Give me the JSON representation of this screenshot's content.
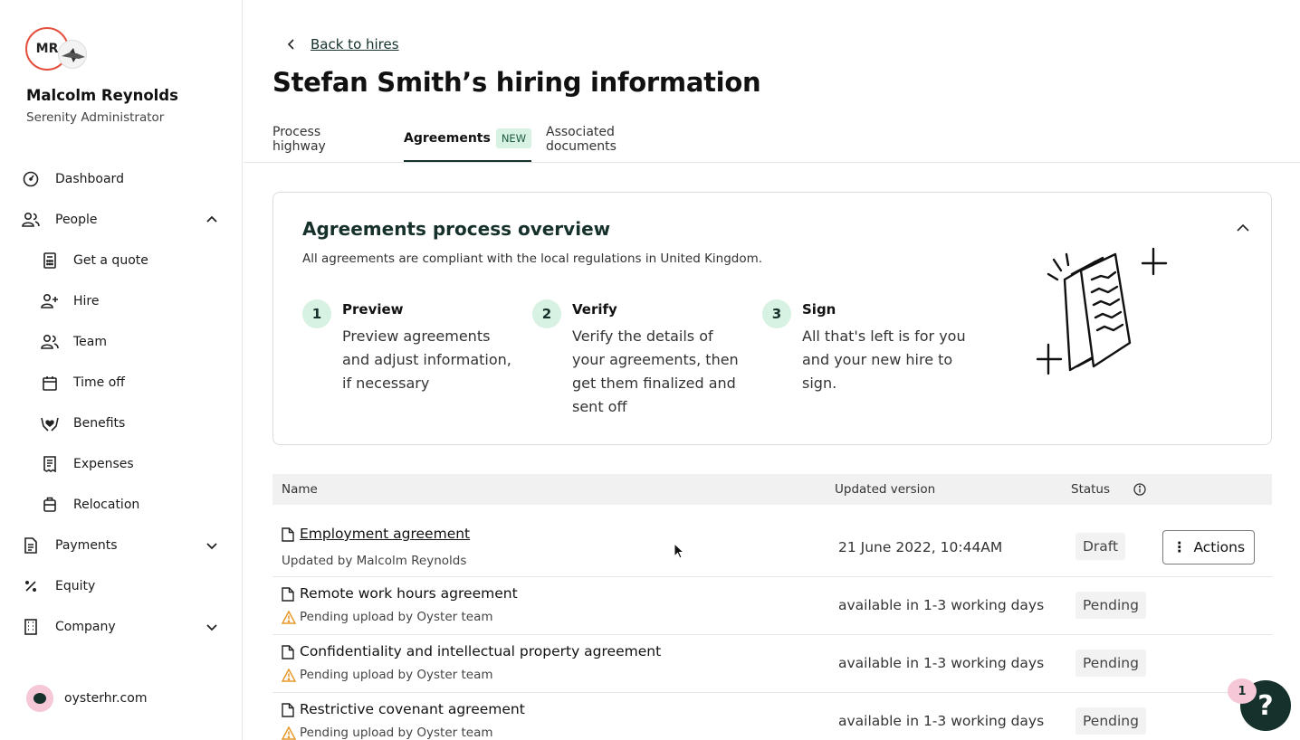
{
  "user": {
    "initials": "MR",
    "name": "Malcolm Reynolds",
    "role": "Serenity Administrator"
  },
  "nav": {
    "dashboard": "Dashboard",
    "people": "People",
    "get_quote": "Get a quote",
    "hire": "Hire",
    "team": "Team",
    "time_off": "Time off",
    "benefits": "Benefits",
    "expenses": "Expenses",
    "relocation": "Relocation",
    "payments": "Payments",
    "equity": "Equity",
    "company": "Company"
  },
  "org": {
    "name": "oysterhr.com"
  },
  "header": {
    "back_label": "Back to hires",
    "title": "Stefan Smith’s hiring information"
  },
  "tabs": [
    {
      "label": "Process highway"
    },
    {
      "label": "Agreements",
      "badge": "NEW"
    },
    {
      "label": "Associated documents"
    }
  ],
  "overview": {
    "title": "Agreements process overview",
    "subtitle": "All agreements are compliant with the local regulations in United Kingdom.",
    "steps": [
      {
        "num": "1",
        "title": "Preview",
        "text": "Preview agreements and adjust information, if necessary"
      },
      {
        "num": "2",
        "title": "Verify",
        "text": "Verify the details of your agreements, then get them finalized and sent off"
      },
      {
        "num": "3",
        "title": "Sign",
        "text": "All that's left is for you and your new hire to sign."
      }
    ]
  },
  "table": {
    "headers": {
      "name": "Name",
      "updated": "Updated version",
      "status": "Status"
    },
    "rows": [
      {
        "name": "Employment agreement",
        "meta": "Updated by Malcolm Reynolds",
        "updated": "21 June 2022, 10:44AM",
        "status": "Draft",
        "action": "Actions"
      },
      {
        "name": "Remote work hours agreement",
        "meta": "Pending upload by Oyster team",
        "updated": "available in 1-3 working days",
        "status": "Pending"
      },
      {
        "name": "Confidentiality and intellectual property agreement",
        "meta": "Pending upload by Oyster team",
        "updated": "available in 1-3 working days",
        "status": "Pending"
      },
      {
        "name": "Restrictive covenant agreement",
        "meta": "Pending upload by Oyster team",
        "updated": "available in 1-3 working days",
        "status": "Pending"
      }
    ]
  },
  "help": {
    "badge_count": "1",
    "label": "?"
  },
  "colors": {
    "brand_dark": "#16312b",
    "accent_mint": "#d7f1e2",
    "avatar_ring": "#e4513f",
    "warning": "#e5992b"
  }
}
